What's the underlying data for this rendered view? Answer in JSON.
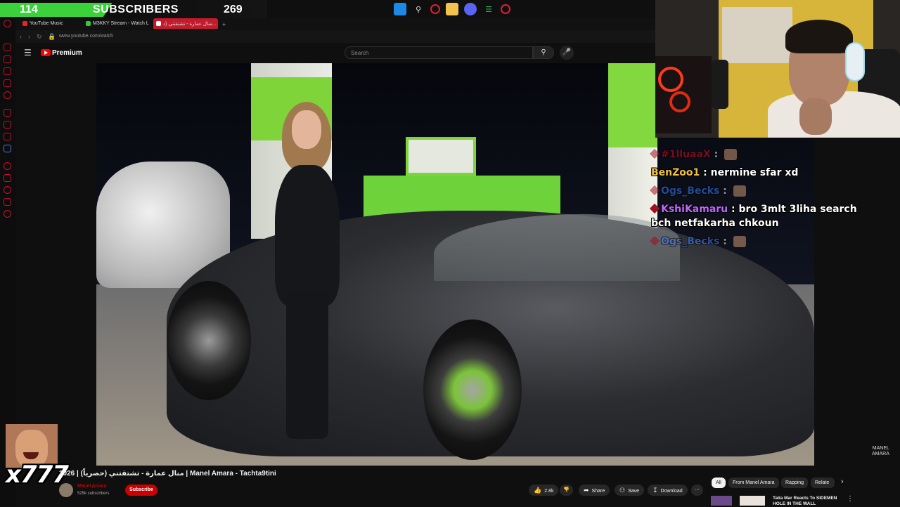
{
  "stream_overlay": {
    "subscriber_count": "114",
    "label": "SUBSCRIBERS",
    "goal": "269",
    "progress": 0.42
  },
  "taskbar": {
    "icons": [
      "windows-icon",
      "search-icon",
      "opera-icon",
      "file-explorer-icon",
      "discord-icon",
      "spotify-icon",
      "obs-icon"
    ]
  },
  "browser": {
    "tabs": [
      {
        "label": "YouTube Music",
        "color": "#e22"
      },
      {
        "label": "M3KKY Stream - Watch L",
        "color": "#3c3"
      },
      {
        "label": "منال عمارة - تشتقتني (د...",
        "color": "#e22"
      }
    ],
    "url": "www.youtube.com/watch"
  },
  "youtube": {
    "brand": "Premium",
    "search_placeholder": "Search"
  },
  "video": {
    "watermark_line1": "MANEL",
    "watermark_line2": "AMARA",
    "title": "2026 | منال عمارة - تشتقتني (حصرياً) | Manel Amara - Tachta9tini",
    "channel_name": "Manel Amara",
    "channel_subs": "525k subscribers",
    "subscribe_label": "Subscribe",
    "likes": "2.8k",
    "share_label": "Share",
    "save_label": "Save",
    "download_label": "Download",
    "more_label": "⋯"
  },
  "chips": [
    {
      "label": "All",
      "active": true
    },
    {
      "label": "From Manel Amara",
      "active": false
    },
    {
      "label": "Rapping",
      "active": false
    },
    {
      "label": "Relate",
      "active": false
    }
  ],
  "recommendation": {
    "title": "Talia Mar Reacts To SIDEMEN HOLE IN THE WALL"
  },
  "chat": [
    {
      "user": "#1lluaaX",
      "color": "#c8102e",
      "message": "",
      "emote": true,
      "dim": true
    },
    {
      "user": "BenZoo1",
      "color": "#f0c040",
      "message": "nermine sfar xd",
      "emote": false,
      "dim": false
    },
    {
      "user": "Ogs_Becks",
      "color": "#3b7bff",
      "message": "",
      "emote": true,
      "dim": true
    },
    {
      "user": "KshiKamaru",
      "color": "#c064ff",
      "message": "bro 3mlt 3liha search bch netfakarha chkoun",
      "emote": false,
      "dim": false
    },
    {
      "user": "Ogs_Becks",
      "color": "#3b7bff",
      "message": "",
      "emote": true,
      "dim": true
    }
  ],
  "meme_overlay": {
    "text": "x777"
  }
}
